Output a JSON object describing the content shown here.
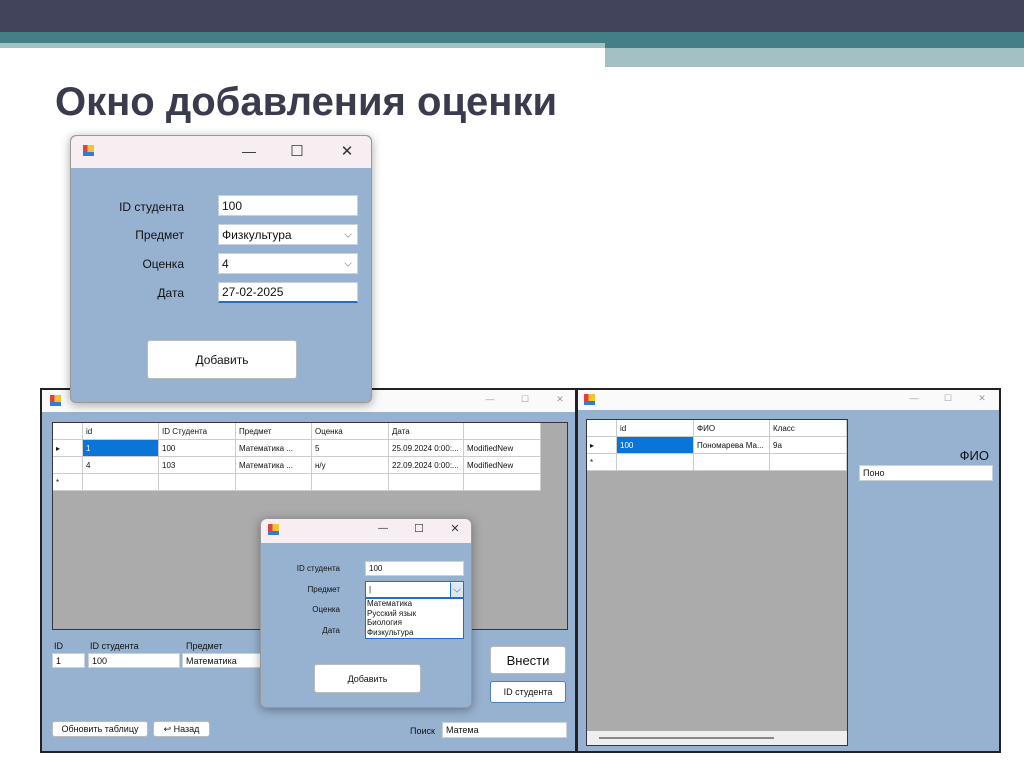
{
  "slide": {
    "title": "Окно добавления оценки",
    "colors": {
      "dark": "#41445a",
      "teal": "#437f84",
      "light": "#a3c0c4",
      "form": "#97b2d0"
    }
  },
  "dialog_top": {
    "labels": [
      "ID студента",
      "Предмет",
      "Оценка",
      "Дата"
    ],
    "student_id": "100",
    "subject": "Физкультура",
    "grade": "4",
    "date": "27-02-2025",
    "add_button": "Добавить",
    "minimize": "—",
    "maximize": "☐",
    "close": "✕"
  },
  "main_window": {
    "columns": [
      "id",
      "ID Студента",
      "Предмет",
      "Оценка",
      "Дата",
      ""
    ],
    "rows": [
      [
        "1",
        "100",
        "Математика    ...",
        "5",
        "25.09.2024 0:00:...",
        "ModifiedNew"
      ],
      [
        "4",
        "103",
        "Математика    ...",
        "н/у",
        "22.09.2024 0:00:...",
        "ModifiedNew"
      ]
    ],
    "row_marker": "▸",
    "new_row_marker": "*",
    "id_label": "ID",
    "id_value": "1",
    "student_label": "ID студента",
    "student_value": "100",
    "subject_label": "Предмет",
    "subject_value": "Математика",
    "submit_button": "Внести",
    "student_id_button": "ID студента",
    "refresh_button": "Обновить таблицу",
    "back_button": "↩ Назад",
    "search_label": "Поиск",
    "search_value": "Матема",
    "minimize": "—",
    "maximize": "☐",
    "close": "✕"
  },
  "dialog_mid": {
    "labels": [
      "ID студента",
      "Предмет",
      "Оценка",
      "Дата"
    ],
    "student_id": "100",
    "subject": "|",
    "options": [
      "Математика",
      "Русский язык",
      "Биология",
      "Физкультура"
    ],
    "add_button": "Добавить",
    "minimize": "—",
    "maximize": "☐",
    "close": "✕"
  },
  "students_window": {
    "columns": [
      "id",
      "ФИО",
      "Класс"
    ],
    "rows": [
      [
        "100",
        "Пономарева Ма...",
        "9а"
      ]
    ],
    "row_marker": "▸",
    "new_row_marker": "*",
    "fio_label": "ФИО",
    "fio_value": "Поно",
    "minimize": "—",
    "maximize": "☐",
    "close": "✕"
  }
}
